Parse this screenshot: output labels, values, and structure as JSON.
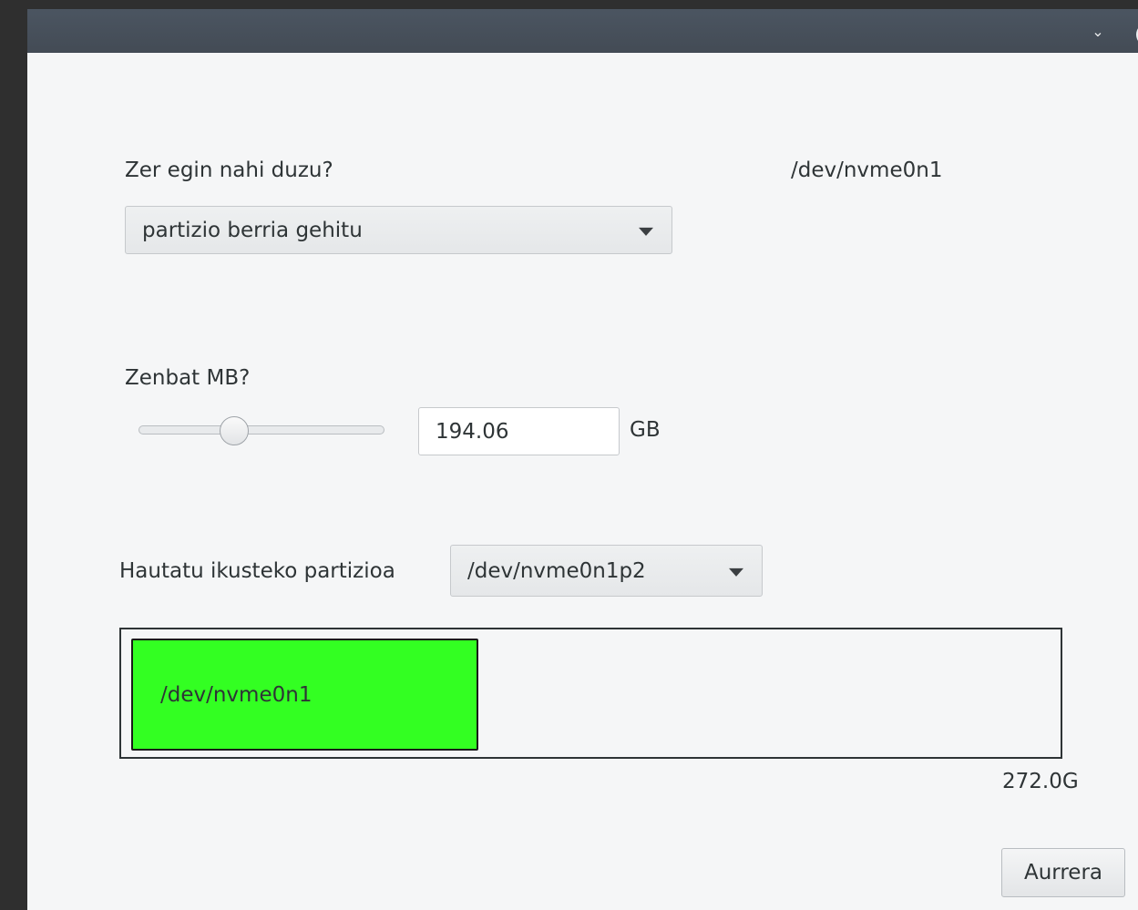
{
  "window": {
    "minimize_glyph": "⌄",
    "close_glyph": "✕",
    "icons": {
      "minimize": "chevron-down-icon",
      "close": "close-icon"
    }
  },
  "action": {
    "label": "Zer egin nahi duzu?",
    "device": "/dev/nvme0n1",
    "selected": "partizio berria gehitu"
  },
  "size": {
    "label": "Zenbat MB?",
    "value": "194.06",
    "unit": "GB",
    "slider_fraction": 0.39
  },
  "partition_view": {
    "label": "Hautatu ikusteko partizioa",
    "selected": "/dev/nvme0n1p2",
    "block_label": "/dev/nvme0n1",
    "block_color": "#33ff22",
    "total_size": "272.0G"
  },
  "buttons": {
    "next_label": "Aurrera"
  }
}
